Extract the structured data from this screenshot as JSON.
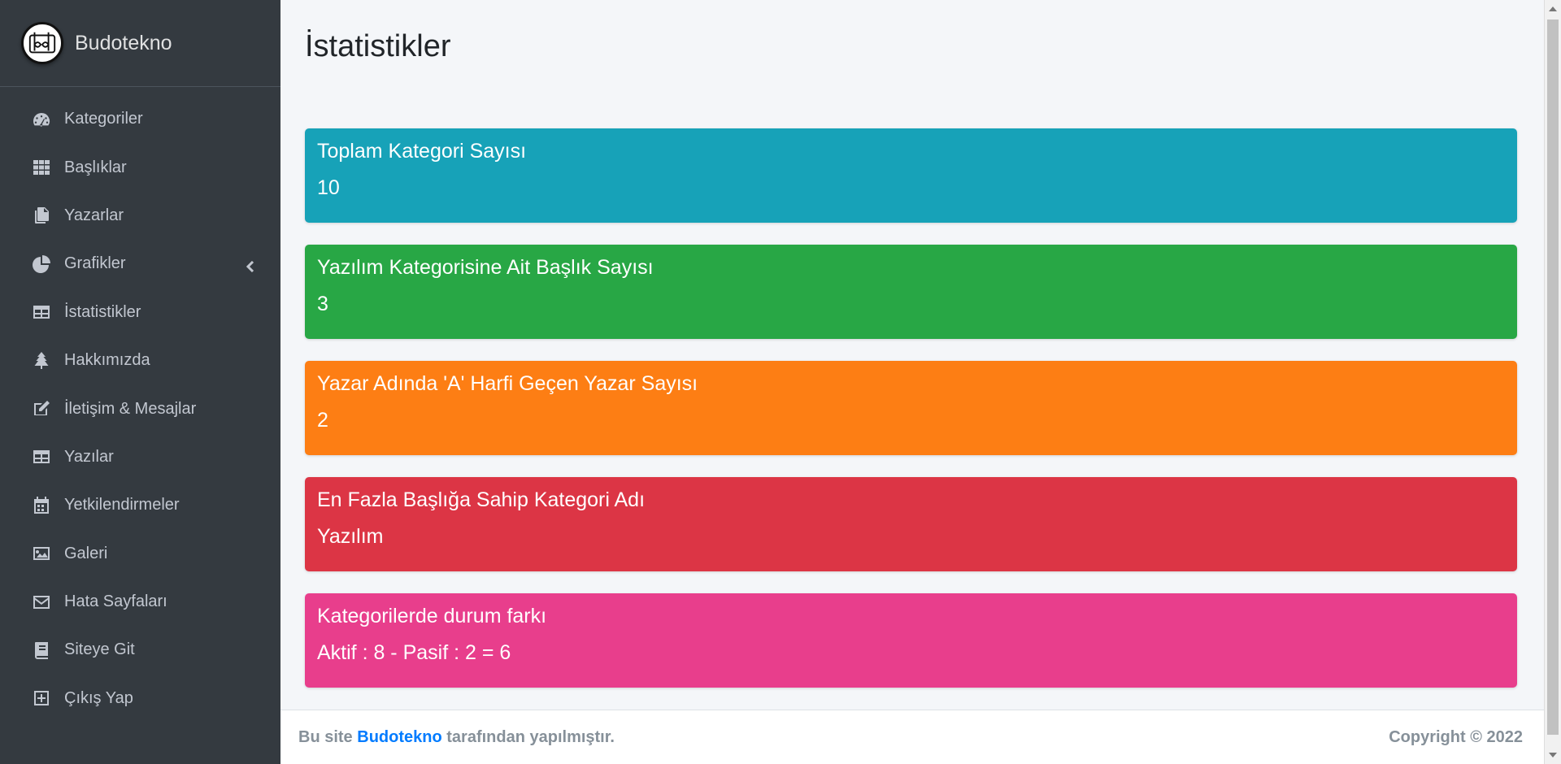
{
  "brand": {
    "name": "Budotekno",
    "logo_icon": "bd-logo-icon"
  },
  "sidebar": {
    "items": [
      {
        "label": "Kategoriler",
        "icon": "tachometer-icon"
      },
      {
        "label": "Başlıklar",
        "icon": "grid-icon"
      },
      {
        "label": "Yazarlar",
        "icon": "copy-icon"
      },
      {
        "label": "Grafikler",
        "icon": "pie-chart-icon",
        "has_submenu": true
      },
      {
        "label": "İstatistikler",
        "icon": "table-icon"
      },
      {
        "label": "Hakkımızda",
        "icon": "tree-icon"
      },
      {
        "label": "İletişim & Mesajlar",
        "icon": "edit-icon"
      },
      {
        "label": "Yazılar",
        "icon": "table-icon"
      },
      {
        "label": "Yetkilendirmeler",
        "icon": "calendar-icon"
      },
      {
        "label": "Galeri",
        "icon": "image-icon"
      },
      {
        "label": "Hata Sayfaları",
        "icon": "envelope-icon"
      },
      {
        "label": "Siteye Git",
        "icon": "book-icon"
      },
      {
        "label": "Çıkış Yap",
        "icon": "plus-square-icon"
      }
    ]
  },
  "page": {
    "title": "İstatistikler"
  },
  "stats": [
    {
      "title": "Toplam Kategori Sayısı",
      "value": "10",
      "color": "#17a2b8"
    },
    {
      "title": "Yazılım Kategorisine Ait Başlık Sayısı",
      "value": "3",
      "color": "#28a745"
    },
    {
      "title": "Yazar Adında 'A' Harfi Geçen Yazar Sayısı",
      "value": "2",
      "color": "#fd7e14"
    },
    {
      "title": "En Fazla Başlığa Sahip Kategori Adı",
      "value": "Yazılım",
      "color": "#dc3545"
    },
    {
      "title": "Kategorilerde durum farkı",
      "value": "Aktif : 8 - Pasif : 2 = 6",
      "color": "#e83e8c"
    }
  ],
  "footer": {
    "prefix": "Bu site",
    "link": "Budotekno",
    "suffix": "tarafından yapılmıştır.",
    "copyright": "Copyright © 2022"
  }
}
